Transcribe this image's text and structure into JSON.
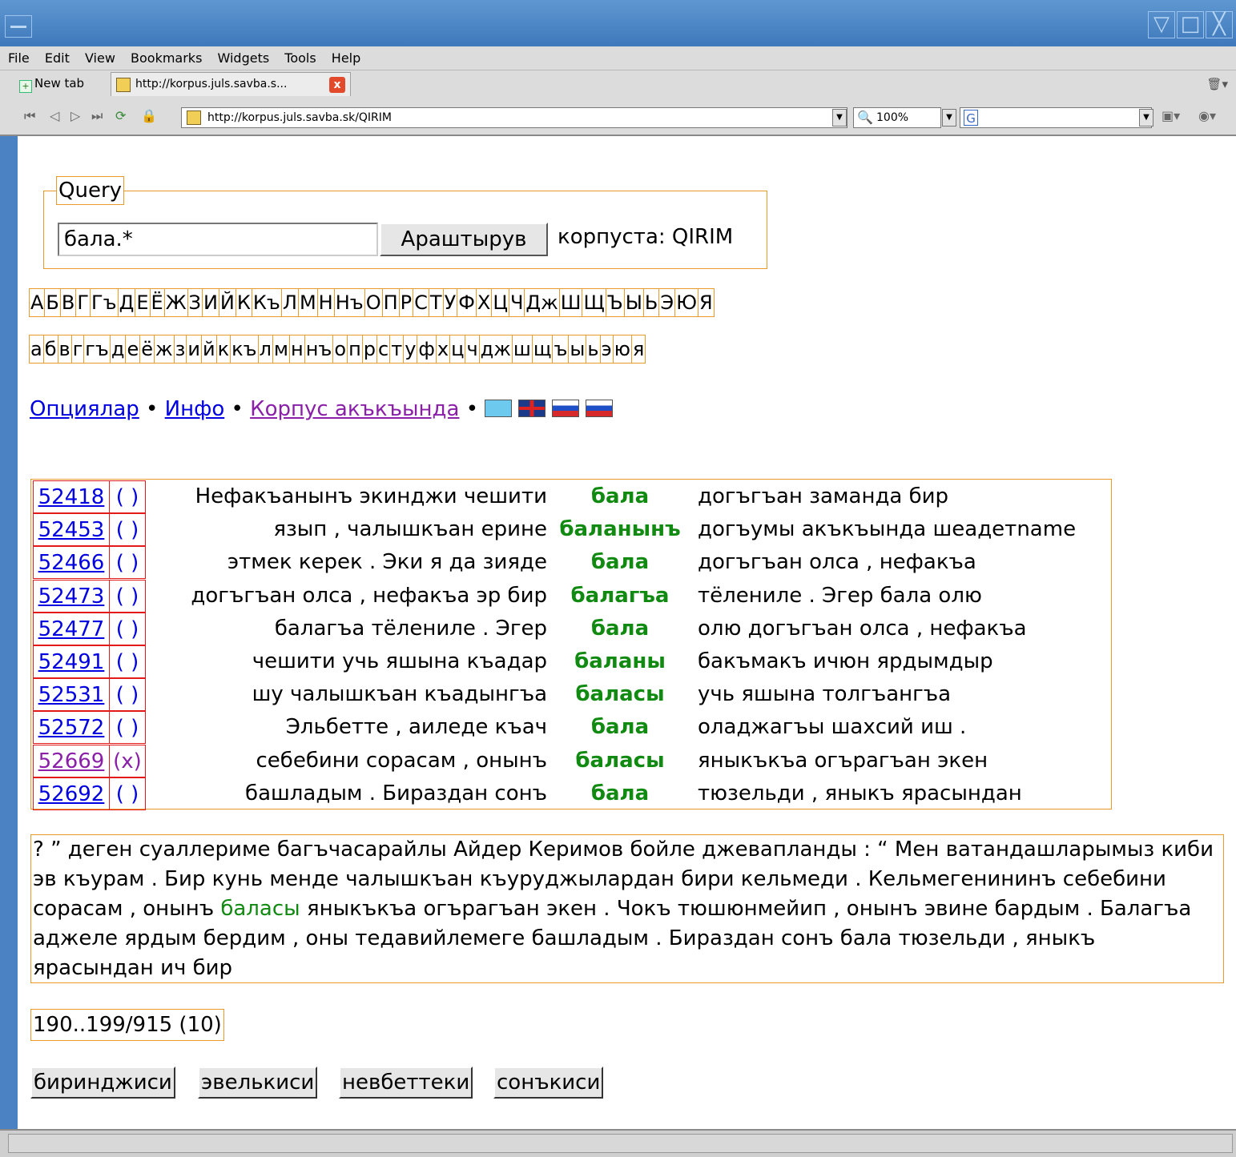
{
  "window": {
    "menu": [
      "File",
      "Edit",
      "View",
      "Bookmarks",
      "Widgets",
      "Tools",
      "Help"
    ],
    "tabs": {
      "new_tab_label": "New tab",
      "active_tab_label": "http://korpus.juls.savba.s...",
      "close_symbol": "x"
    },
    "address": {
      "url": "http://korpus.juls.savba.sk/QIRIM",
      "zoom": "100%",
      "search_icon_letter": "G"
    }
  },
  "query": {
    "legend": "Query",
    "input_value": "бала.*",
    "search_button": "Араштырув",
    "corpus_label": "корпуста: QIRIM"
  },
  "alphabet_upper": [
    "А",
    "Б",
    "В",
    "Г",
    "Гъ",
    "Д",
    "Е",
    "Ё",
    "Ж",
    "З",
    "И",
    "Й",
    "К",
    "Къ",
    "Л",
    "М",
    "Н",
    "Нъ",
    "О",
    "П",
    "Р",
    "С",
    "Т",
    "У",
    "Ф",
    "Х",
    "Ц",
    "Ч",
    "Дж",
    "Ш",
    "Щ",
    "Ъ",
    "Ы",
    "Ь",
    "Э",
    "Ю",
    "Я"
  ],
  "alphabet_lower": [
    "а",
    "б",
    "в",
    "г",
    "гъ",
    "д",
    "е",
    "ё",
    "ж",
    "з",
    "и",
    "й",
    "к",
    "къ",
    "л",
    "м",
    "н",
    "нъ",
    "о",
    "п",
    "р",
    "с",
    "т",
    "у",
    "ф",
    "х",
    "ц",
    "ч",
    "дж",
    "ш",
    "щ",
    "ъ",
    "ы",
    "ь",
    "э",
    "ю",
    "я"
  ],
  "links": {
    "options": "Опциялар",
    "info": "Инфо",
    "about": "Корпус акъкъында",
    "separator": "•"
  },
  "results": [
    {
      "id": "52418",
      "mark": "( )",
      "left": "Нефакъанынъ экинджи чешити",
      "kw": "бала",
      "right": "догъгъан заманда бир"
    },
    {
      "id": "52453",
      "mark": "( )",
      "left": "язып , чалышкъан ерине",
      "kw": "баланынъ",
      "right": "догъумы акъкъында шеадетname"
    },
    {
      "id": "52466",
      "mark": "( )",
      "left": "этмек керек . Эки я да зияде",
      "kw": "бала",
      "right": "догъгъан олса , нефакъа"
    },
    {
      "id": "52473",
      "mark": "( )",
      "left": "догъгъан олса , нефакъа эр бир",
      "kw": "балагъа",
      "right": "тёлениле . Эгер бала олю"
    },
    {
      "id": "52477",
      "mark": "( )",
      "left": "балагъа тёлениле . Эгер",
      "kw": "бала",
      "right": "олю догъгъан олса , нефакъа"
    },
    {
      "id": "52491",
      "mark": "( )",
      "left": "чешити учь яшына къадар",
      "kw": "баланы",
      "right": "бакъмакъ ичюн ярдымдыр"
    },
    {
      "id": "52531",
      "mark": "( )",
      "left": "шу чалышкъан къадынгъа",
      "kw": "баласы",
      "right": "учь яшына толгъангъа"
    },
    {
      "id": "52572",
      "mark": "( )",
      "left": "Эльбетте , аиледе къач",
      "kw": "бала",
      "right": "оладжагъы шахсий иш ."
    },
    {
      "id": "52669",
      "mark": "(x)",
      "left": "себебини сорасам , онынъ",
      "kw": "баласы",
      "right": "яныкъкъа огърагъан экен",
      "visited": true
    },
    {
      "id": "52692",
      "mark": "( )",
      "left": "башладым . Бираздан сонъ",
      "kw": "бала",
      "right": "тюзельди , яныкъ ярасындан"
    }
  ],
  "context": {
    "before": "? ” деген суаллериме багъчасарайлы Айдер Керимов бойле джевапланды : “ Мен ватандашларымыз киби эв къурам . Бир кунь менде чалышкъан къуруджылардан бири кельмеди . Кельмегенининъ себебини сорасам , онынъ ",
    "kw": "баласы",
    "after": " яныкъкъа огърагъан экен . Чокъ тюшюнмейип , онынъ эвине бардым . Балагъа аджеле ярдым бердим , оны тедавийлемеге башладым . Бираздан сонъ бала тюзельди , яныкъ ярасындан ич бир"
  },
  "pager": "190..199/915 (10)",
  "nav_buttons": {
    "first": "биринджиси",
    "prev": "эвелькиси",
    "next": "невбеттеки",
    "last": "сонъкиси"
  },
  "colors": {
    "accent_border": "#e89a2d",
    "id_border": "#e41a1a",
    "keyword": "#118a11",
    "link": "#0000e0",
    "visited_link": "#8a1fa8"
  }
}
